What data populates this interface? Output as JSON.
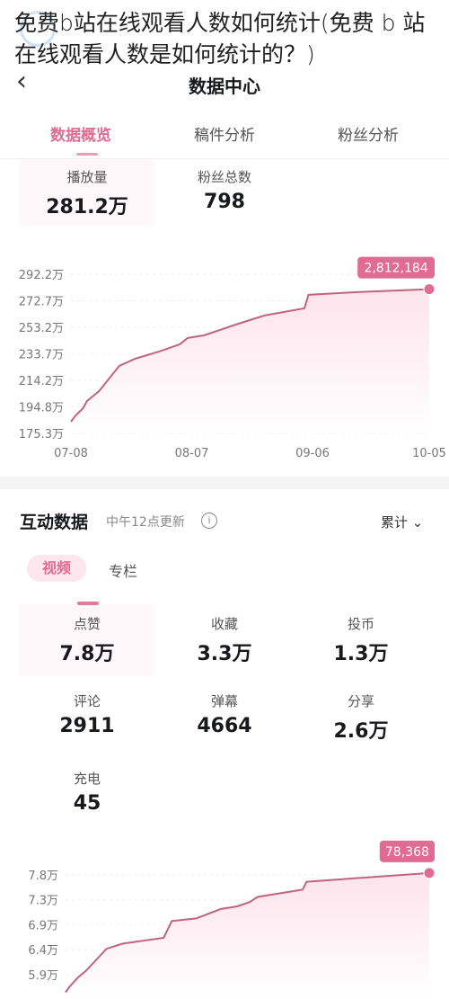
{
  "page_title": "免费b站在线观看人数如何统计(免费 b 站在线观看人数是如何统计的？)",
  "nav": {
    "back_icon": "chevron-left-icon",
    "title": "数据中心"
  },
  "tabs": [
    {
      "label": "数据概览",
      "active": true
    },
    {
      "label": "稿件分析"
    },
    {
      "label": "粉丝分析"
    }
  ],
  "overview": [
    {
      "label": "播放量",
      "value": "281.2万"
    },
    {
      "label": "粉丝总数",
      "value": "798"
    }
  ],
  "interaction": {
    "title": "互动数据",
    "subtitle": "中午12点更新",
    "info_icon": "info-circle-icon",
    "range_select": "累计",
    "sub_tabs": [
      "视频",
      "专栏"
    ],
    "metrics": [
      {
        "label": "点赞",
        "value": "7.8万"
      },
      {
        "label": "收藏",
        "value": "3.3万"
      },
      {
        "label": "投币",
        "value": "1.3万"
      },
      {
        "label": "评论",
        "value": "2911"
      },
      {
        "label": "弹幕",
        "value": "4664"
      },
      {
        "label": "分享",
        "value": "2.6万"
      },
      {
        "label": "充电",
        "value": "45"
      }
    ]
  },
  "colors": {
    "accent": "#e06b93",
    "line": "#c0647f",
    "fill": "#fde3ec"
  },
  "chart_data": [
    {
      "type": "area",
      "yunit": "万",
      "yticks": [
        "292.2万",
        "272.7万",
        "253.2万",
        "233.7万",
        "214.2万",
        "194.8万",
        "175.3万"
      ],
      "ytick_values": [
        292.2,
        272.7,
        253.2,
        233.7,
        214.2,
        194.8,
        175.3
      ],
      "xticks": [
        "07-08",
        "08-07",
        "09-06",
        "10-05"
      ],
      "ylim": [
        175.3,
        292.2
      ],
      "grid": true,
      "last_label": "2,812,184",
      "points": [
        [
          "07-08",
          183.9
        ],
        [
          "07-09",
          187.9
        ],
        [
          "07-11",
          193.8
        ],
        [
          "07-12",
          199.1
        ],
        [
          "07-15",
          206.4
        ],
        [
          "07-20",
          224.9
        ],
        [
          "07-24",
          230.2
        ],
        [
          "07-30",
          235.5
        ],
        [
          "08-04",
          240.7
        ],
        [
          "08-06",
          245.4
        ],
        [
          "08-10",
          247.3
        ],
        [
          "08-18",
          255.3
        ],
        [
          "08-25",
          261.9
        ],
        [
          "09-04",
          267.2
        ],
        [
          "09-05",
          277.1
        ],
        [
          "09-17",
          279.1
        ],
        [
          "10-05",
          281.2
        ]
      ]
    },
    {
      "type": "area",
      "yunit": "万",
      "yticks": [
        "7.8万",
        "7.3万",
        "6.9万",
        "6.4万",
        "5.9万"
      ],
      "ytick_values": [
        7.8,
        7.325,
        6.85,
        6.375,
        5.9
      ],
      "xticks": [],
      "ylim": [
        5.45,
        7.8
      ],
      "grid": true,
      "last_label": "78,368",
      "points": [
        [
          "07-08",
          5.56
        ],
        [
          "07-09",
          5.67
        ],
        [
          "07-11",
          5.84
        ],
        [
          "07-13",
          5.97
        ],
        [
          "07-18",
          6.39
        ],
        [
          "07-22",
          6.49
        ],
        [
          "08-01",
          6.6
        ],
        [
          "08-03",
          6.92
        ],
        [
          "08-09",
          6.97
        ],
        [
          "08-15",
          7.15
        ],
        [
          "08-19",
          7.2
        ],
        [
          "08-22",
          7.28
        ],
        [
          "08-24",
          7.38
        ],
        [
          "09-04",
          7.52
        ],
        [
          "09-05",
          7.67
        ],
        [
          "10-05",
          7.8368
        ]
      ]
    }
  ]
}
